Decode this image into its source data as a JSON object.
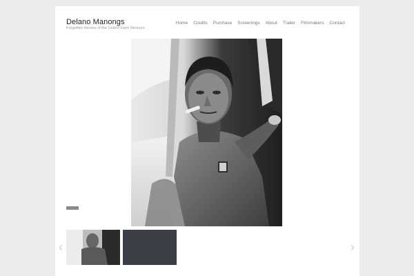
{
  "site": {
    "title": "Delano Manongs",
    "tagline": "Forgotten Heroes of the United Farm Workers"
  },
  "nav": {
    "items": [
      "Home",
      "Credits",
      "Purchase",
      "Screenings",
      "About",
      "Trailer",
      "Filmmakers",
      "Contact"
    ]
  },
  "gallery": {
    "main_image": "black-and-white photo of a man with a cigar leaning out of a car window",
    "thumbnails": [
      "thumbnail of man in car",
      "dark blank thumbnail"
    ],
    "prev_icon": "chevron-left-icon",
    "next_icon": "chevron-right-icon"
  },
  "colors": {
    "background": "#ececec",
    "page": "#ffffff",
    "nav_text": "#777777",
    "arrow": "#cfcfcf"
  }
}
